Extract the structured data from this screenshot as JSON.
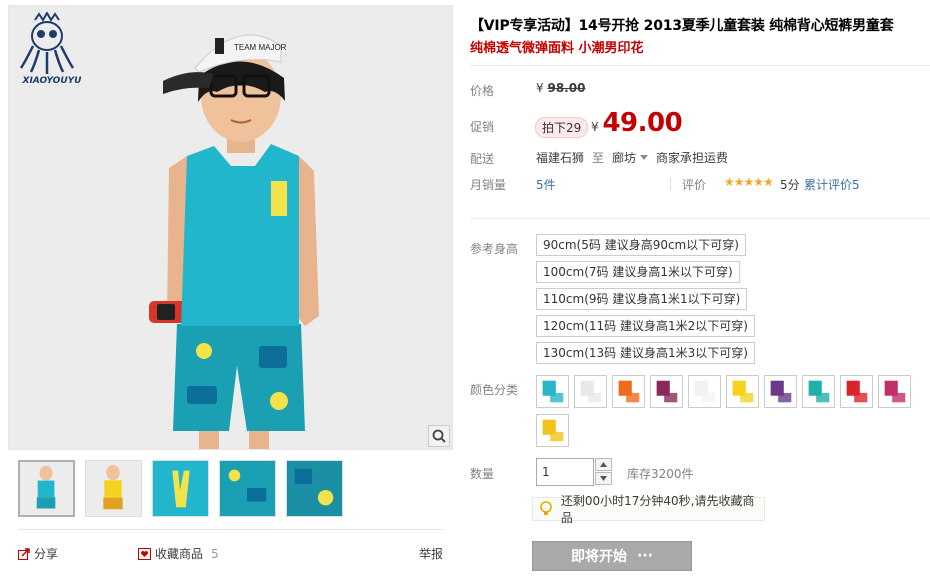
{
  "brand": {
    "logo_text": "XIAOYOUYU"
  },
  "gallery": {
    "hero_alt": "main-product-photo",
    "thumbnails": [
      {
        "name": "thumb-1"
      },
      {
        "name": "thumb-2"
      },
      {
        "name": "thumb-3"
      },
      {
        "name": "thumb-4"
      },
      {
        "name": "thumb-5"
      }
    ],
    "share_label": "分享",
    "favorite_label": "收藏商品",
    "favorite_count": "5",
    "report_label": "举报",
    "cap_text": "TEAM MAJOR"
  },
  "product": {
    "title": "【VIP专享活动】14号开抢 2013夏季儿童套装 纯棉背心短裤男童套",
    "subtitle": "纯棉透气微弹面料 小潮男印花"
  },
  "price": {
    "label": "价格",
    "currency": "¥",
    "original": "98.00"
  },
  "promo": {
    "label": "促销",
    "badge": "拍下29",
    "currency": "¥",
    "price": "49.00"
  },
  "shipping": {
    "label": "配送",
    "from": "福建石狮",
    "to_word": "至",
    "destination": "廊坊",
    "note": "商家承担运费"
  },
  "sales": {
    "label": "月销量",
    "value": "5件",
    "rating_label": "评价",
    "stars": "★★★★★",
    "score": "5分",
    "review_label": "累计评价",
    "review_count": "5"
  },
  "options": {
    "size_label": "参考身高",
    "sizes": [
      "90cm(5码 建议身高90cm以下可穿)",
      "100cm(7码 建议身高1米以下可穿)",
      "110cm(9码 建议身高1米1以下可穿)",
      "120cm(11码 建议身高1米2以下可穿)",
      "130cm(13码 建议身高1米3以下可穿)"
    ],
    "color_label": "颜色分类",
    "colors": [
      "#27b5c8",
      "#e8e8e8",
      "#f06a1e",
      "#8a2a5a",
      "#f2f2f2",
      "#f4d21e",
      "#6a3a8a",
      "#1fb0a8",
      "#d8242a",
      "#c0306a",
      "#f4c21e"
    ]
  },
  "quantity": {
    "label": "数量",
    "value": "1",
    "stock": "库存3200件"
  },
  "notice": {
    "text": "还剩00小时17分钟40秒,请先收藏商品"
  },
  "action": {
    "label": "即将开始",
    "dots": "···"
  },
  "colors": {
    "accent_red": "#c40000",
    "link_blue": "#3d6ea8",
    "button_gray": "#a9a9a9",
    "star": "#f5a623"
  }
}
